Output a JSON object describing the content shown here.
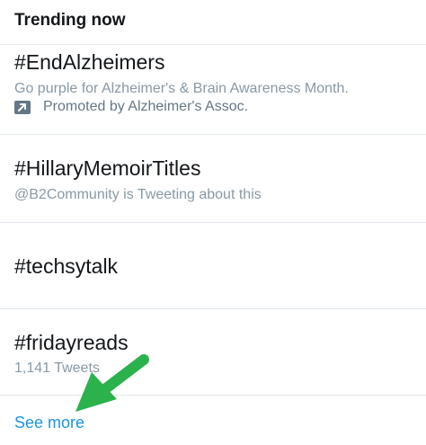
{
  "header": {
    "title": "Trending now"
  },
  "trends": [
    {
      "name": "#EndAlzheimers",
      "description": "Go purple for Alzheimer's & Brain Awareness Month.",
      "promoted": "Promoted by Alzheimer's Assoc."
    },
    {
      "name": "#HillaryMemoirTitles",
      "context": "@B2Community is Tweeting about this"
    },
    {
      "name": "#techsytalk"
    },
    {
      "name": "#fridayreads",
      "tweet_count": "1,141 Tweets"
    }
  ],
  "footer": {
    "see_more": "See more"
  },
  "icons": {
    "promoted": "promoted-arrow-icon",
    "annotation": "green-arrow"
  },
  "colors": {
    "link": "#1b95e0",
    "annotation_arrow": "#2bb24c",
    "meta_text": "#8899a6",
    "divider": "#e1e8ed"
  }
}
